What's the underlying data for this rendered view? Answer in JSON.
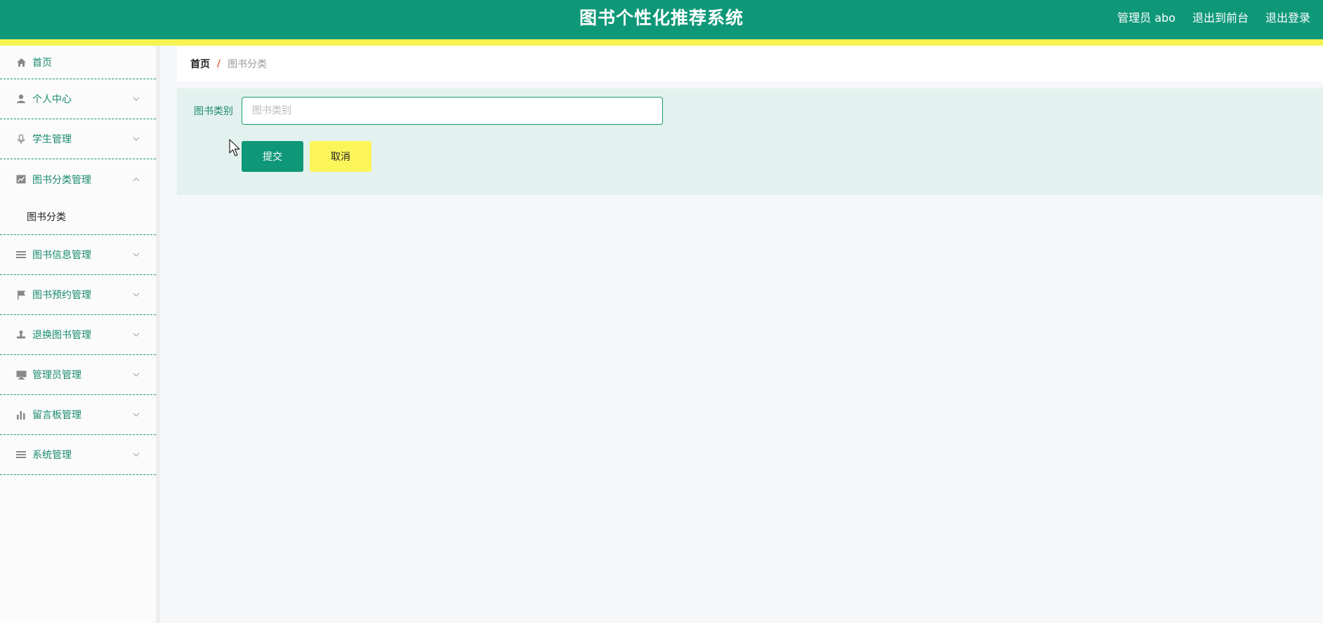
{
  "header": {
    "title": "图书个性化推荐系统",
    "admin_label": "管理员 abo",
    "to_front_label": "退出到前台",
    "logout_label": "退出登录"
  },
  "colors": {
    "primary": "#0f9878",
    "accent_yellow": "#f6f452",
    "panel_bg": "#e3f2ee"
  },
  "sidebar": {
    "items": [
      {
        "label": "首页",
        "icon": "home-icon"
      },
      {
        "label": "个人中心",
        "icon": "user-icon"
      },
      {
        "label": "学生管理",
        "icon": "microphone-icon"
      },
      {
        "label": "图书分类管理",
        "icon": "chart-icon",
        "expanded": true,
        "children": [
          {
            "label": "图书分类"
          }
        ]
      },
      {
        "label": "图书信息管理",
        "icon": "list-icon"
      },
      {
        "label": "图书预约管理",
        "icon": "flag-icon"
      },
      {
        "label": "退换图书管理",
        "icon": "stamp-icon"
      },
      {
        "label": "管理员管理",
        "icon": "monitor-icon"
      },
      {
        "label": "留言板管理",
        "icon": "bar-chart-icon"
      },
      {
        "label": "系统管理",
        "icon": "menu-icon"
      }
    ]
  },
  "breadcrumb": {
    "home": "首页",
    "separator": "/",
    "current": "图书分类"
  },
  "form": {
    "category_label": "图书类别",
    "category_value": "",
    "category_placeholder": "图书类别",
    "submit_label": "提交",
    "cancel_label": "取消"
  }
}
